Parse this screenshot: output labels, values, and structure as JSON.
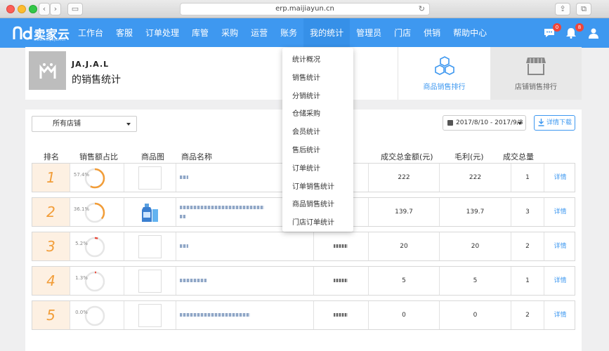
{
  "browser": {
    "url": "erp.maijiayun.cn"
  },
  "brand": {
    "name": "卖家云",
    "url": "www.maijiayun.cn"
  },
  "nav": {
    "items": [
      "工作台",
      "客服",
      "订单处理",
      "库管",
      "采购",
      "运营",
      "账务",
      "我的统计",
      "管理员",
      "门店",
      "供销",
      "帮助中心"
    ],
    "active_index": 7,
    "message_badge": "0",
    "notify_badge": "8"
  },
  "header": {
    "shop_name": "JA.J.A.L",
    "title": "的销售统计",
    "tabs": [
      "商品销售排行",
      "店铺销售排行"
    ]
  },
  "filters": {
    "store": "所有店铺",
    "date_range": "2017/8/10 - 2017/9/8",
    "download_label": "详情下载"
  },
  "table": {
    "headers": {
      "rank": "排名",
      "ratio": "销售额占比",
      "image": "商品图",
      "name": "商品名称",
      "amount": "成交总金额(元)",
      "profit": "毛利(元)",
      "qty": "成交总量"
    },
    "detail_label": "详情",
    "rows": [
      {
        "rank": "1",
        "ratio": "57.4%",
        "ratio_value": 57.4,
        "amount": "222",
        "profit": "222",
        "qty": "1"
      },
      {
        "rank": "2",
        "ratio": "36.1%",
        "ratio_value": 36.1,
        "amount": "139.7",
        "profit": "139.7",
        "qty": "3"
      },
      {
        "rank": "3",
        "ratio": "5.2%",
        "ratio_value": 5.2,
        "amount": "20",
        "profit": "20",
        "qty": "2"
      },
      {
        "rank": "4",
        "ratio": "1.3%",
        "ratio_value": 1.3,
        "amount": "5",
        "profit": "5",
        "qty": "1"
      },
      {
        "rank": "5",
        "ratio": "0.0%",
        "ratio_value": 0.0,
        "amount": "0",
        "profit": "0",
        "qty": "2"
      }
    ]
  },
  "dropdown": {
    "items": [
      "统计概况",
      "销售统计",
      "分销统计",
      "仓储采购",
      "会员统计",
      "售后统计",
      "订单统计",
      "订单销售统计",
      "商品销售统计",
      "门店订单统计"
    ]
  },
  "colors": {
    "primary": "#3e98f0",
    "rank_orange": "#f29d38",
    "ring_red": "#e84a3c"
  }
}
